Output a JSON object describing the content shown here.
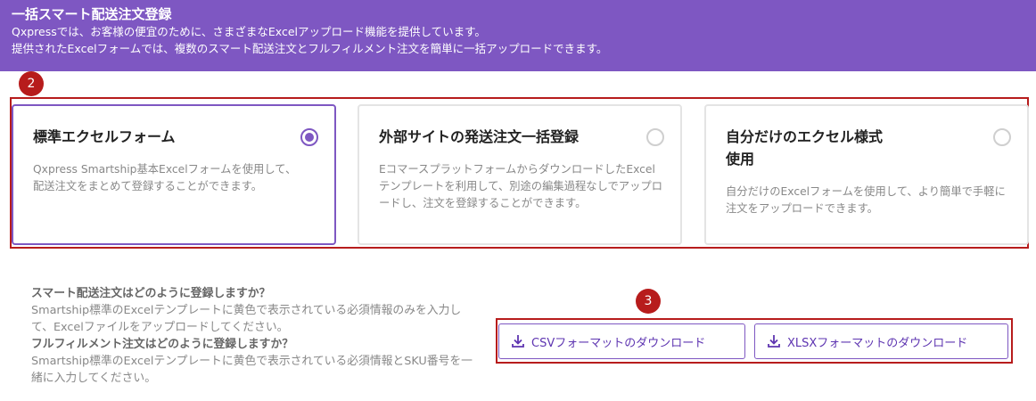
{
  "header": {
    "title": "一括スマート配送注文登録",
    "line1": "Qxpressでは、お客様の便宜のために、さまざまなExcelアップロード機能を提供しています。",
    "line2": "提供されたExcelフォームでは、複数のスマート配送注文とフルフィルメント注文を簡単に一括アップロードできます。"
  },
  "badges": {
    "cards": "2",
    "downloads": "3"
  },
  "cards": [
    {
      "title": "標準エクセルフォーム",
      "desc": "Qxpress Smartship基本Excelフォームを使用して、配送注文をまとめて登録することができます。",
      "selected": true
    },
    {
      "title": "外部サイトの発送注文一括登録",
      "desc": "EコマースプラットフォームからダウンロードしたExcelテンプレートを利用して、別途の編集過程なしでアップロードし、注文を登録することができます。",
      "selected": false
    },
    {
      "title": "自分だけのエクセル様式使用",
      "desc": "自分だけのExcelフォームを使用して、より簡単で手軽に注文をアップロードできます。",
      "selected": false
    }
  ],
  "help": {
    "q1": "スマート配送注文はどのように登録しますか？",
    "a1": "Smartship標準のExcelテンプレートに黄色で表示されている必須情報のみを入力して、Excelファイルをアップロードしてください。",
    "q2": "フルフィルメント注文はどのように登録しますか？",
    "a2": "Smartship標準のExcelテンプレートに黄色で表示されている必須情報とSKU番号を一緒に入力してください。"
  },
  "downloads": {
    "csv_label": "CSVフォーマットのダウンロード",
    "xlsx_label": "XLSXフォーマットのダウンロード"
  },
  "colors": {
    "accent": "#7e57c2",
    "highlight": "#b71c1c"
  },
  "icons": {
    "download": "download-icon"
  }
}
